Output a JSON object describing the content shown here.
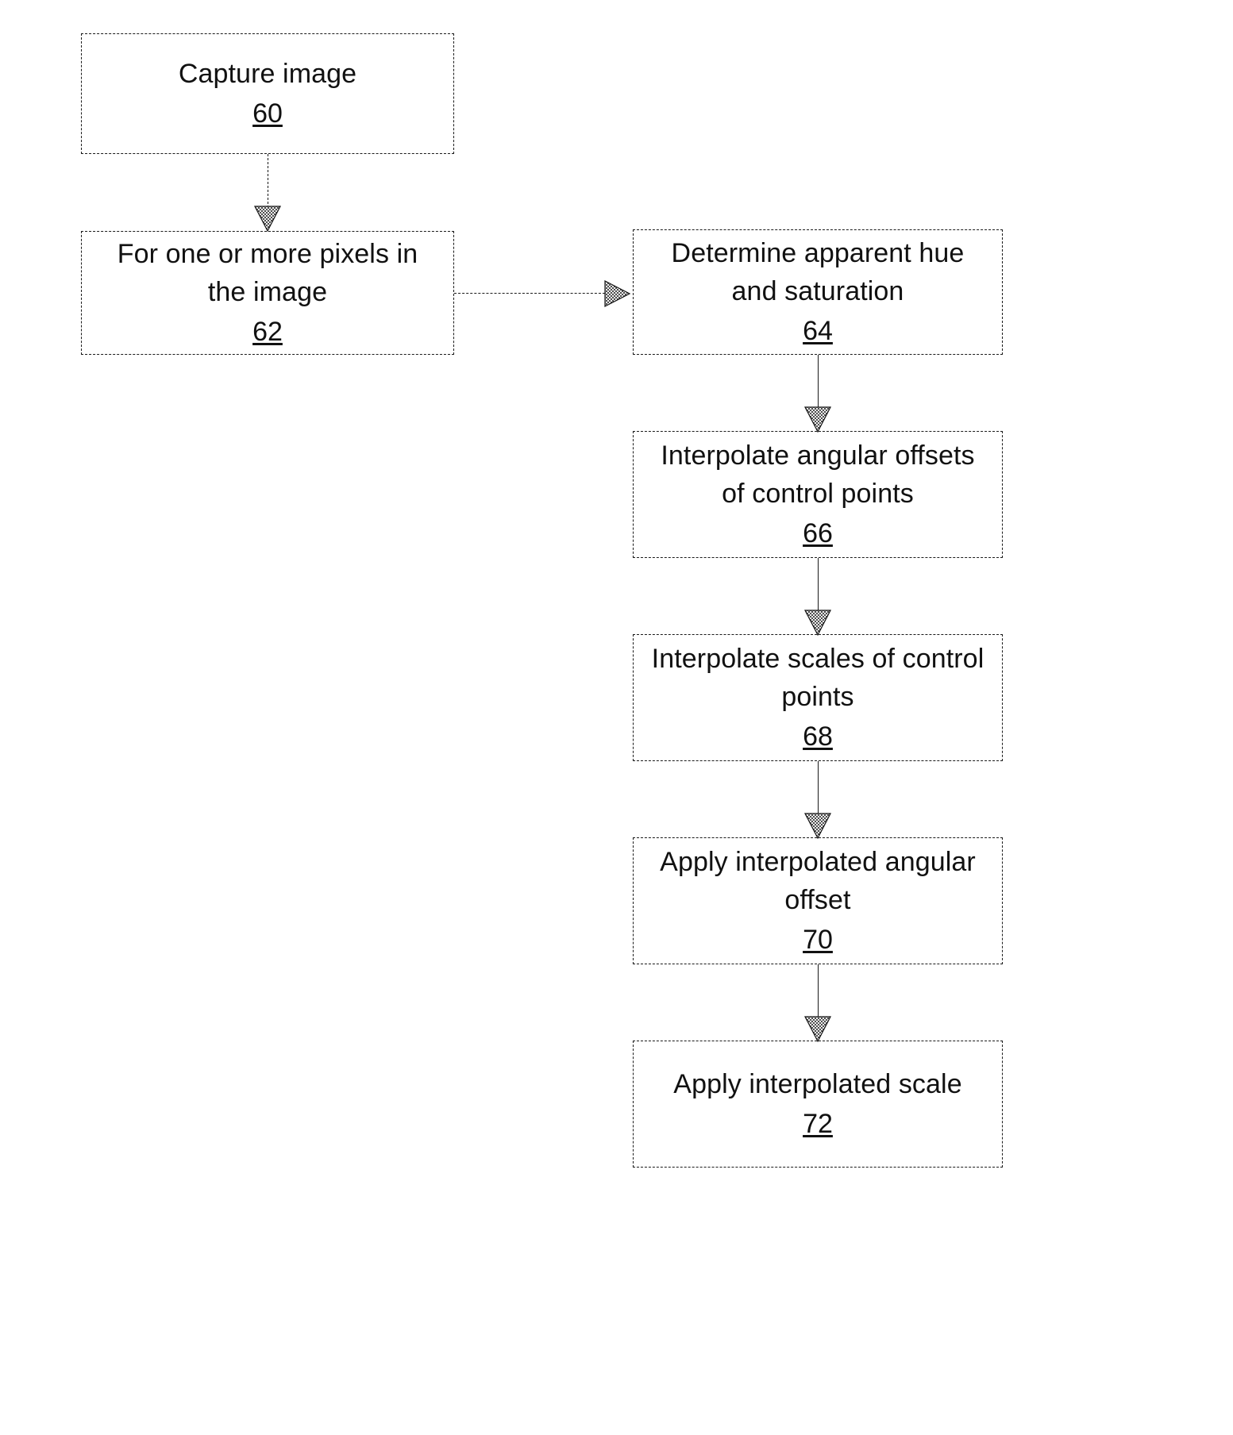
{
  "figure": {
    "type": "flowchart",
    "orientation": "two-column",
    "background_color": "#ffffff",
    "line_color": "#1a1a1a",
    "box_border_style": "dashed",
    "arrow_style": "solid-filled-triangle-hatched"
  },
  "nodes": [
    {
      "id": "n60",
      "label": "Capture image",
      "ref": "60",
      "column": "left"
    },
    {
      "id": "n62",
      "label": "For one or more pixels in\nthe image",
      "ref": "62",
      "column": "left"
    },
    {
      "id": "n64",
      "label": "Determine apparent hue\nand saturation",
      "ref": "64",
      "column": "right"
    },
    {
      "id": "n66",
      "label": "Interpolate angular offsets\nof control points",
      "ref": "66",
      "column": "right"
    },
    {
      "id": "n68",
      "label": "Interpolate scales of control\npoints",
      "ref": "68",
      "column": "right"
    },
    {
      "id": "n70",
      "label": "Apply interpolated angular\noffset",
      "ref": "70",
      "column": "right"
    },
    {
      "id": "n72",
      "label": "Apply interpolated scale",
      "ref": "72",
      "column": "right"
    }
  ],
  "edges": [
    {
      "id": "e60-62",
      "from": "60",
      "to": "62",
      "direction": "down",
      "style": "dashed"
    },
    {
      "id": "e62-64",
      "from": "62",
      "to": "64",
      "direction": "right",
      "style": "dashed"
    },
    {
      "id": "e64-66",
      "from": "64",
      "to": "66",
      "direction": "down",
      "style": "solid"
    },
    {
      "id": "e66-68",
      "from": "66",
      "to": "68",
      "direction": "down",
      "style": "solid"
    },
    {
      "id": "e68-70",
      "from": "68",
      "to": "70",
      "direction": "down",
      "style": "solid"
    },
    {
      "id": "e70-72",
      "from": "70",
      "to": "72",
      "direction": "down",
      "style": "solid"
    }
  ]
}
